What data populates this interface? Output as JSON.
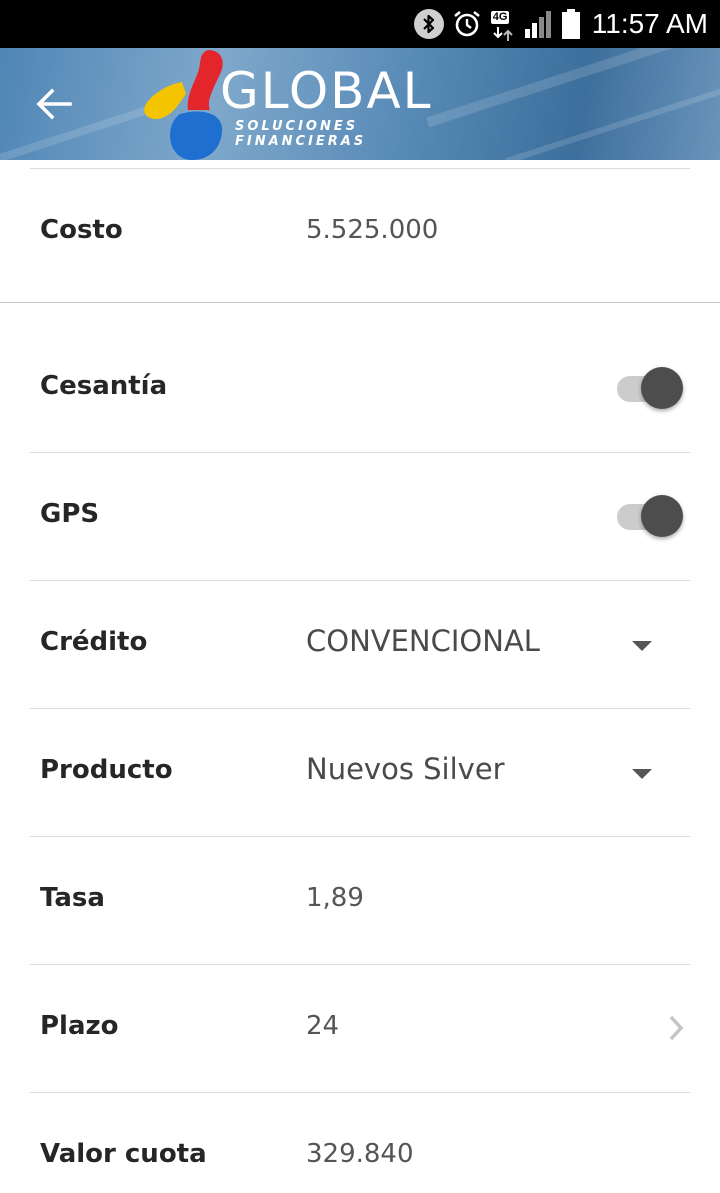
{
  "status_bar": {
    "time": "11:57 AM",
    "network_type": "4G",
    "icons": [
      "bluetooth-icon",
      "alarm-icon",
      "network-4g-icon",
      "signal-icon",
      "battery-icon"
    ]
  },
  "app_bar": {
    "back_icon": "arrow-left-icon",
    "logo_name": "GLOBAL",
    "logo_tagline": "SOLUCIONES FINANCIERAS"
  },
  "form": {
    "costo": {
      "label": "Costo",
      "value": "5.525.000"
    },
    "cesantia": {
      "label": "Cesantía",
      "checked": true
    },
    "gps": {
      "label": "GPS",
      "checked": true
    },
    "credito": {
      "label": "Crédito",
      "selected": "CONVENCIONAL"
    },
    "producto": {
      "label": "Producto",
      "selected": "Nuevos Silver"
    },
    "tasa": {
      "label": "Tasa",
      "value": "1,89"
    },
    "plazo": {
      "label": "Plazo",
      "value": "24"
    },
    "valor_cuota": {
      "label": "Valor cuota",
      "value": "329.840"
    }
  },
  "colors": {
    "toggle_thumb": "#4d4d4d",
    "toggle_track": "#cccccc",
    "label_text": "#262626",
    "value_text": "#555555",
    "logo_red": "#e3262b",
    "logo_yellow": "#f5c400",
    "logo_blue": "#1f6fd1"
  }
}
